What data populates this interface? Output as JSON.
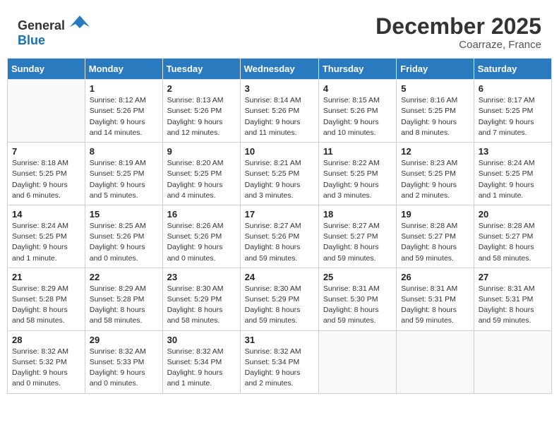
{
  "header": {
    "logo_general": "General",
    "logo_blue": "Blue",
    "month": "December 2025",
    "location": "Coarraze, France"
  },
  "weekdays": [
    "Sunday",
    "Monday",
    "Tuesday",
    "Wednesday",
    "Thursday",
    "Friday",
    "Saturday"
  ],
  "weeks": [
    [
      {
        "num": "",
        "sunrise": "",
        "sunset": "",
        "daylight": ""
      },
      {
        "num": "1",
        "sunrise": "Sunrise: 8:12 AM",
        "sunset": "Sunset: 5:26 PM",
        "daylight": "Daylight: 9 hours and 14 minutes."
      },
      {
        "num": "2",
        "sunrise": "Sunrise: 8:13 AM",
        "sunset": "Sunset: 5:26 PM",
        "daylight": "Daylight: 9 hours and 12 minutes."
      },
      {
        "num": "3",
        "sunrise": "Sunrise: 8:14 AM",
        "sunset": "Sunset: 5:26 PM",
        "daylight": "Daylight: 9 hours and 11 minutes."
      },
      {
        "num": "4",
        "sunrise": "Sunrise: 8:15 AM",
        "sunset": "Sunset: 5:26 PM",
        "daylight": "Daylight: 9 hours and 10 minutes."
      },
      {
        "num": "5",
        "sunrise": "Sunrise: 8:16 AM",
        "sunset": "Sunset: 5:25 PM",
        "daylight": "Daylight: 9 hours and 8 minutes."
      },
      {
        "num": "6",
        "sunrise": "Sunrise: 8:17 AM",
        "sunset": "Sunset: 5:25 PM",
        "daylight": "Daylight: 9 hours and 7 minutes."
      }
    ],
    [
      {
        "num": "7",
        "sunrise": "Sunrise: 8:18 AM",
        "sunset": "Sunset: 5:25 PM",
        "daylight": "Daylight: 9 hours and 6 minutes."
      },
      {
        "num": "8",
        "sunrise": "Sunrise: 8:19 AM",
        "sunset": "Sunset: 5:25 PM",
        "daylight": "Daylight: 9 hours and 5 minutes."
      },
      {
        "num": "9",
        "sunrise": "Sunrise: 8:20 AM",
        "sunset": "Sunset: 5:25 PM",
        "daylight": "Daylight: 9 hours and 4 minutes."
      },
      {
        "num": "10",
        "sunrise": "Sunrise: 8:21 AM",
        "sunset": "Sunset: 5:25 PM",
        "daylight": "Daylight: 9 hours and 3 minutes."
      },
      {
        "num": "11",
        "sunrise": "Sunrise: 8:22 AM",
        "sunset": "Sunset: 5:25 PM",
        "daylight": "Daylight: 9 hours and 3 minutes."
      },
      {
        "num": "12",
        "sunrise": "Sunrise: 8:23 AM",
        "sunset": "Sunset: 5:25 PM",
        "daylight": "Daylight: 9 hours and 2 minutes."
      },
      {
        "num": "13",
        "sunrise": "Sunrise: 8:24 AM",
        "sunset": "Sunset: 5:25 PM",
        "daylight": "Daylight: 9 hours and 1 minute."
      }
    ],
    [
      {
        "num": "14",
        "sunrise": "Sunrise: 8:24 AM",
        "sunset": "Sunset: 5:25 PM",
        "daylight": "Daylight: 9 hours and 1 minute."
      },
      {
        "num": "15",
        "sunrise": "Sunrise: 8:25 AM",
        "sunset": "Sunset: 5:26 PM",
        "daylight": "Daylight: 9 hours and 0 minutes."
      },
      {
        "num": "16",
        "sunrise": "Sunrise: 8:26 AM",
        "sunset": "Sunset: 5:26 PM",
        "daylight": "Daylight: 9 hours and 0 minutes."
      },
      {
        "num": "17",
        "sunrise": "Sunrise: 8:27 AM",
        "sunset": "Sunset: 5:26 PM",
        "daylight": "Daylight: 8 hours and 59 minutes."
      },
      {
        "num": "18",
        "sunrise": "Sunrise: 8:27 AM",
        "sunset": "Sunset: 5:27 PM",
        "daylight": "Daylight: 8 hours and 59 minutes."
      },
      {
        "num": "19",
        "sunrise": "Sunrise: 8:28 AM",
        "sunset": "Sunset: 5:27 PM",
        "daylight": "Daylight: 8 hours and 59 minutes."
      },
      {
        "num": "20",
        "sunrise": "Sunrise: 8:28 AM",
        "sunset": "Sunset: 5:27 PM",
        "daylight": "Daylight: 8 hours and 58 minutes."
      }
    ],
    [
      {
        "num": "21",
        "sunrise": "Sunrise: 8:29 AM",
        "sunset": "Sunset: 5:28 PM",
        "daylight": "Daylight: 8 hours and 58 minutes."
      },
      {
        "num": "22",
        "sunrise": "Sunrise: 8:29 AM",
        "sunset": "Sunset: 5:28 PM",
        "daylight": "Daylight: 8 hours and 58 minutes."
      },
      {
        "num": "23",
        "sunrise": "Sunrise: 8:30 AM",
        "sunset": "Sunset: 5:29 PM",
        "daylight": "Daylight: 8 hours and 58 minutes."
      },
      {
        "num": "24",
        "sunrise": "Sunrise: 8:30 AM",
        "sunset": "Sunset: 5:29 PM",
        "daylight": "Daylight: 8 hours and 59 minutes."
      },
      {
        "num": "25",
        "sunrise": "Sunrise: 8:31 AM",
        "sunset": "Sunset: 5:30 PM",
        "daylight": "Daylight: 8 hours and 59 minutes."
      },
      {
        "num": "26",
        "sunrise": "Sunrise: 8:31 AM",
        "sunset": "Sunset: 5:31 PM",
        "daylight": "Daylight: 8 hours and 59 minutes."
      },
      {
        "num": "27",
        "sunrise": "Sunrise: 8:31 AM",
        "sunset": "Sunset: 5:31 PM",
        "daylight": "Daylight: 8 hours and 59 minutes."
      }
    ],
    [
      {
        "num": "28",
        "sunrise": "Sunrise: 8:32 AM",
        "sunset": "Sunset: 5:32 PM",
        "daylight": "Daylight: 9 hours and 0 minutes."
      },
      {
        "num": "29",
        "sunrise": "Sunrise: 8:32 AM",
        "sunset": "Sunset: 5:33 PM",
        "daylight": "Daylight: 9 hours and 0 minutes."
      },
      {
        "num": "30",
        "sunrise": "Sunrise: 8:32 AM",
        "sunset": "Sunset: 5:34 PM",
        "daylight": "Daylight: 9 hours and 1 minute."
      },
      {
        "num": "31",
        "sunrise": "Sunrise: 8:32 AM",
        "sunset": "Sunset: 5:34 PM",
        "daylight": "Daylight: 9 hours and 2 minutes."
      },
      {
        "num": "",
        "sunrise": "",
        "sunset": "",
        "daylight": ""
      },
      {
        "num": "",
        "sunrise": "",
        "sunset": "",
        "daylight": ""
      },
      {
        "num": "",
        "sunrise": "",
        "sunset": "",
        "daylight": ""
      }
    ]
  ]
}
